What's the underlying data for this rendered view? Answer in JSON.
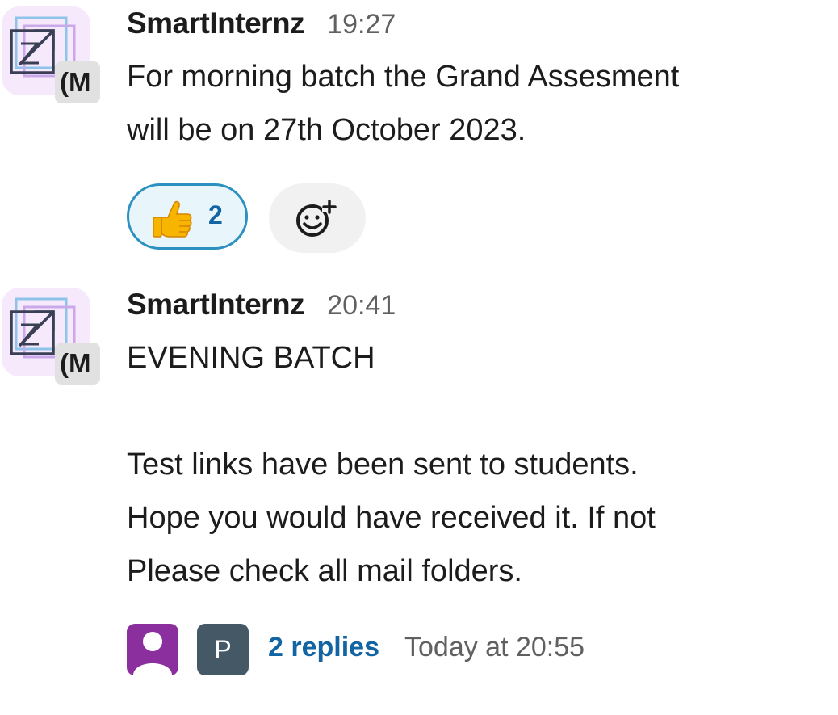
{
  "messages": [
    {
      "sender": "SmartInternz",
      "time": "19:27",
      "avatar_badge": "(M",
      "body": [
        "For morning batch the Grand Assesment",
        "will be on 27th October 2023."
      ],
      "reactions": [
        {
          "emoji": "thumbs-up-emoji",
          "count": "2"
        }
      ],
      "add_reaction_icon": "add-reaction-icon"
    },
    {
      "sender": "SmartInternz",
      "time": "20:41",
      "avatar_badge": "(M",
      "body": [
        "EVENING BATCH",
        "",
        "Test links have been sent to students.",
        "Hope you would have received it. If not",
        "Please check all mail folders."
      ],
      "thread": {
        "participant_initial": "P",
        "replies": "2 replies",
        "last_reply": "Today at 20:55"
      }
    }
  ],
  "colors": {
    "link": "#1264a3",
    "reaction_border": "#2c91c1",
    "reaction_bg": "#e8f5fa",
    "avatar_bg": "#f6e9fb",
    "thread_avatar_purple": "#8b2f9f",
    "thread_avatar_slate": "#445866"
  }
}
